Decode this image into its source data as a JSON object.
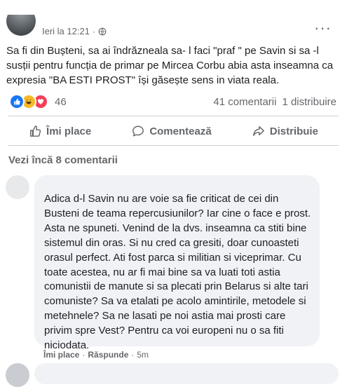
{
  "post": {
    "time": "Ieri la 12:21",
    "privacy_separator": "·",
    "more_label": "···",
    "text": "Sa fi din Bușteni, sa ai îndrăzneala sa- l faci \"praf \" pe Savin si sa -l susții pentru funcția de primar pe Mircea Corbu abia asta inseamna ca expresia \"BA ESTI PROST\" își găsește sens in viata reala.",
    "reaction_count": "46",
    "comments_count": "41 comentarii",
    "shares_count": "1 distribuire",
    "reactions": [
      "like",
      "haha",
      "love"
    ]
  },
  "actions": {
    "like": "Îmi place",
    "comment": "Comentează",
    "share": "Distribuie"
  },
  "comments": {
    "view_more": "Vezi încă 8 comentarii",
    "items": [
      {
        "text": "Adica d-l Savin nu are voie sa fie criticat de cei din Busteni de teama repercusiunilor? Iar cine o face e prost. Asta ne spuneti. Venind de la dvs. inseamna ca stiti bine sistemul din oras. Si nu cred ca gresiti, doar cunoasteti orasul perfect. Ati fost parca si militian si viceprimar. Cu toate acestea, nu ar fi mai bine sa va luati toti astia comunistii de manute si sa plecati prin Belarus si alte tari comuniste? Sa va etalati pe acolo amintirile, metodele si metehnele? Sa ne lasati pe noi astia mai prosti care privim spre Vest? Pentru ca voi europeni nu o sa fiti niciodata.",
        "like_label": "Îmi place",
        "reply_label": "Răspunde",
        "time": "5m"
      }
    ]
  },
  "colors": {
    "accent": "#1877f2",
    "muted": "#65676b",
    "bubble": "#f0f2f5"
  }
}
